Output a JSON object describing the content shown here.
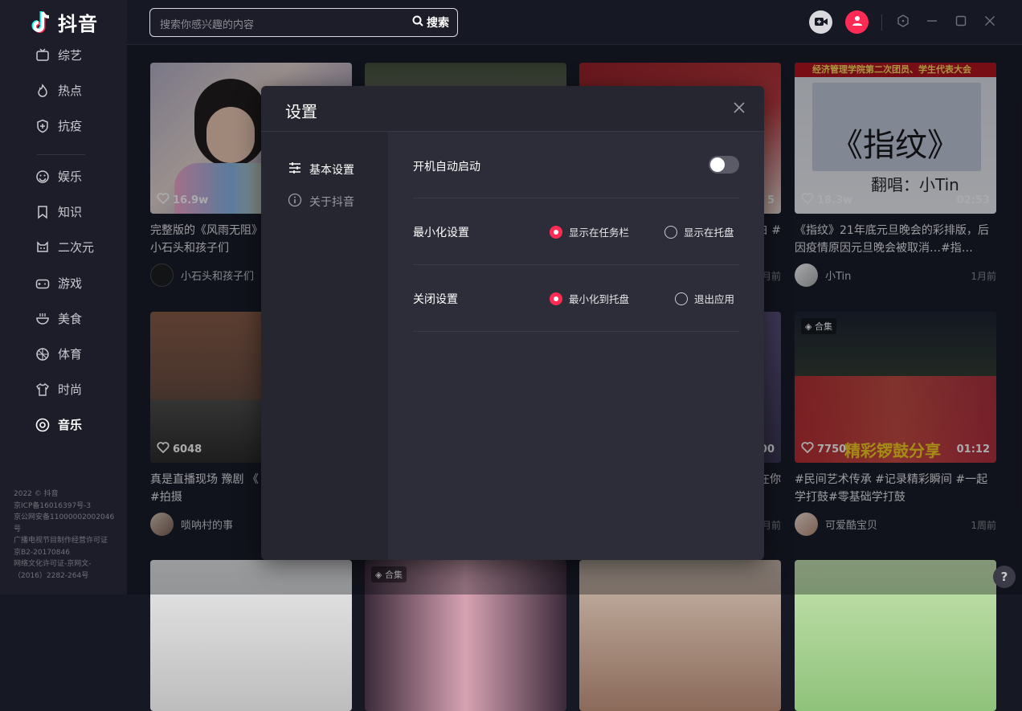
{
  "app": {
    "logo_text": "抖音"
  },
  "colors": {
    "accent": "#fe2c55",
    "background": "#161823",
    "sidebar": "#1c1d29"
  },
  "sidebar": {
    "items": [
      {
        "label": "综艺",
        "icon": "tv-icon"
      },
      {
        "label": "热点",
        "icon": "flame-icon"
      },
      {
        "label": "抗疫",
        "icon": "shield-plus-icon"
      },
      {
        "label": "娱乐",
        "icon": "smile-icon"
      },
      {
        "label": "知识",
        "icon": "bookmark-icon"
      },
      {
        "label": "二次元",
        "icon": "cat-icon"
      },
      {
        "label": "游戏",
        "icon": "gamepad-icon"
      },
      {
        "label": "美食",
        "icon": "bowl-icon"
      },
      {
        "label": "体育",
        "icon": "ball-icon"
      },
      {
        "label": "时尚",
        "icon": "shirt-icon"
      },
      {
        "label": "音乐",
        "icon": "disc-icon"
      }
    ],
    "active": "音乐",
    "footer": [
      "2022 © 抖音",
      "京ICP备16016397号-3",
      "京公网安备11000002002046号",
      "广播电视节目制作经营许可证",
      "京B2-20170846",
      "网络文化许可证-京网文-（2016）2282-264号"
    ]
  },
  "search": {
    "placeholder": "搜索你感兴趣的内容",
    "button_label": "搜索"
  },
  "cards": [
    {
      "likes": "16.9w",
      "duration": "",
      "title": "完整版的《风雨无阻》#童声 #唱歌 #小石头和孩子们",
      "author": "小石头和孩子们",
      "ago": "",
      "collection": ""
    },
    {
      "likes": "",
      "duration": "",
      "title": "",
      "author": "",
      "ago": "",
      "collection": ""
    },
    {
      "likes": "",
      "duration": "5",
      "title": "白 #",
      "author": "",
      "ago": "月前",
      "collection": ""
    },
    {
      "likes": "18.3w",
      "duration": "02:53",
      "title": "《指纹》21年底元旦晚会的彩排版，后因疫情原因元旦晚会被取消…#指…",
      "author": "小Tin",
      "ago": "1月前",
      "collection": "",
      "overlay_text": "《指纹》",
      "overlay_sub": "翻唱：小Tin",
      "banner": "经济管理学院第二次团员、学生代表大会"
    },
    {
      "likes": "6048",
      "duration": "",
      "title": "真是直播现场 豫剧 《 艺术传承 #唢呐 #拍摄",
      "author": "唢呐村的事",
      "ago": "",
      "collection": ""
    },
    {
      "likes": "",
      "duration": "00",
      "title": "在你",
      "author": "",
      "ago": "月前",
      "collection": ""
    },
    {
      "likes": "7750",
      "duration": "01:12",
      "title": "#民间艺术传承 #记录精彩瞬间 #一起学打鼓#零基础学打鼓",
      "author": "可爱酷宝贝",
      "ago": "1周前",
      "collection": "合集",
      "overlay_text": "精彩锣鼓分享"
    },
    {
      "collection": "合集"
    }
  ],
  "settings": {
    "title": "设置",
    "nav": [
      {
        "label": "基本设置",
        "icon": "sliders-icon"
      },
      {
        "label": "关于抖音",
        "icon": "info-icon"
      }
    ],
    "autostart": {
      "label": "开机自动启动",
      "enabled": false
    },
    "minimize": {
      "label": "最小化设置",
      "options": [
        "显示在任务栏",
        "显示在托盘"
      ],
      "selected": "显示在任务栏"
    },
    "close": {
      "label": "关闭设置",
      "options": [
        "最小化到托盘",
        "退出应用"
      ],
      "selected": "最小化到托盘"
    }
  },
  "help_label": "?"
}
